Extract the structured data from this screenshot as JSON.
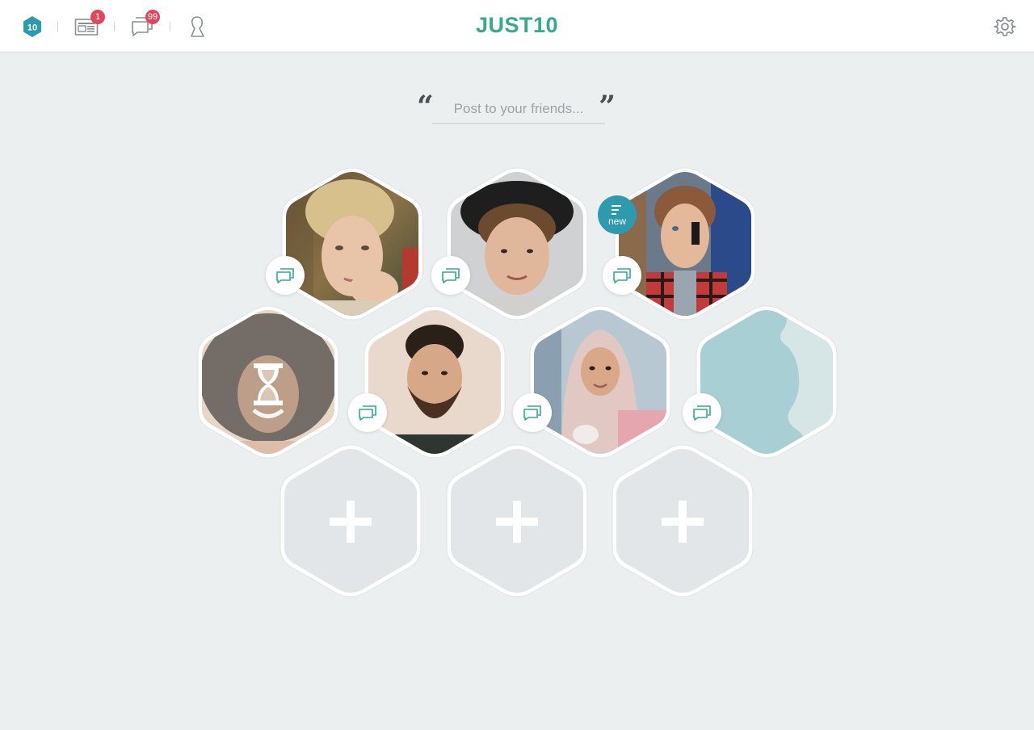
{
  "app": {
    "brand": "JUST10",
    "logo_badge_text": "10",
    "accent_color": "#36a98f",
    "secondary_color": "#2e9aae",
    "badge_color": "#e2465c"
  },
  "nav": {
    "items": [
      {
        "name": "just10-logo",
        "icon": "hexagon-10-icon"
      },
      {
        "name": "news-feed",
        "icon": "newspaper-icon",
        "badge": "1"
      },
      {
        "name": "messages",
        "icon": "chat-bubbles-icon",
        "badge": "99"
      },
      {
        "name": "profile",
        "icon": "person-bust-icon"
      }
    ],
    "settings_icon": "gear-icon"
  },
  "post": {
    "placeholder": "Post to your friends...",
    "open_quote": "“",
    "close_quote": "”"
  },
  "friends": [
    {
      "slot": 1,
      "type": "photo",
      "description": "woman with blonde hair, hand on cheek",
      "chat_icon": "chat-icon"
    },
    {
      "slot": 2,
      "type": "photo",
      "description": "young man with curly hair and black hat",
      "chat_icon": "chat-icon"
    },
    {
      "slot": 3,
      "type": "photo",
      "description": "woman on phone in plaid shirt",
      "chat_icon": "chat-icon",
      "new_badge": "new"
    },
    {
      "slot": 4,
      "type": "pending",
      "description": "smiling woman with curly hair",
      "status_icon": "hourglass-icon"
    },
    {
      "slot": 5,
      "type": "photo",
      "description": "bearded man in dark t-shirt",
      "chat_icon": "chat-icon"
    },
    {
      "slot": 6,
      "type": "photo",
      "description": "woman in hijab holding cup",
      "chat_icon": "chat-icon"
    },
    {
      "slot": 7,
      "type": "placeholder",
      "description": "default silhouette avatar",
      "chat_icon": "chat-icon"
    },
    {
      "slot": 8,
      "type": "add",
      "icon": "plus-icon"
    },
    {
      "slot": 9,
      "type": "add",
      "icon": "plus-icon"
    },
    {
      "slot": 10,
      "type": "add",
      "icon": "plus-icon"
    }
  ]
}
